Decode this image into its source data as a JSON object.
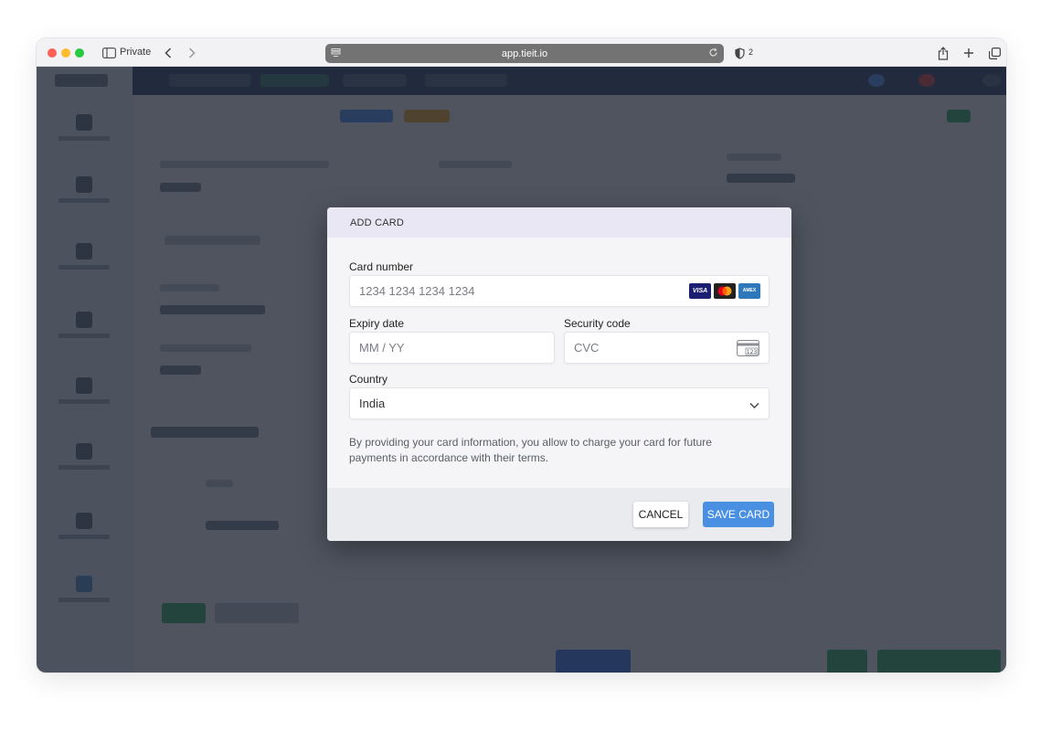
{
  "browser": {
    "private_label": "Private",
    "url": "app.tieit.io",
    "shield_count": "2"
  },
  "modal": {
    "title": "ADD CARD",
    "card_number": {
      "label": "Card number",
      "placeholder": "1234 1234 1234 1234"
    },
    "card_brands": {
      "visa": "VISA",
      "amex": "AMEX"
    },
    "expiry": {
      "label": "Expiry date",
      "placeholder": "MM / YY"
    },
    "security": {
      "label": "Security code",
      "placeholder": "CVC"
    },
    "country": {
      "label": "Country",
      "value": "India"
    },
    "disclaimer": "By providing your card information, you allow to charge your card for future payments in accordance with their terms.",
    "cancel_label": "CANCEL",
    "save_label": "SAVE CARD"
  },
  "colors": {
    "save_button": "#4a90e2",
    "header_band": "#e9e7f3",
    "overlay": "#262c3a"
  }
}
